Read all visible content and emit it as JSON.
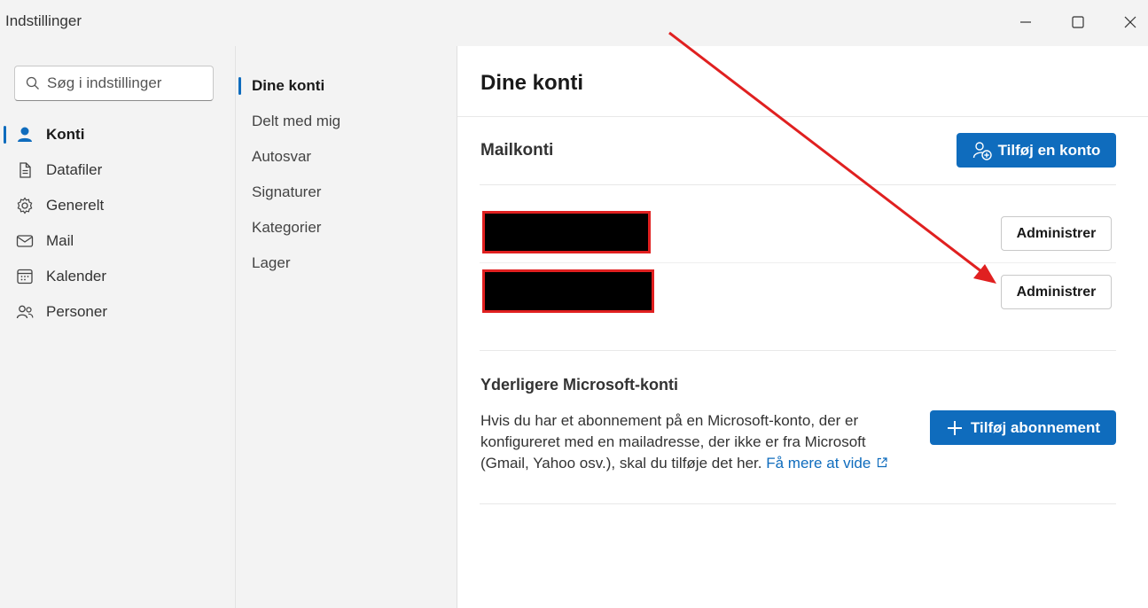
{
  "window": {
    "title": "Indstillinger"
  },
  "search": {
    "placeholder": "Søg i indstillinger"
  },
  "sidebar": {
    "items": [
      {
        "label": "Konti",
        "icon": "person-icon",
        "active": true
      },
      {
        "label": "Datafiler",
        "icon": "document-icon"
      },
      {
        "label": "Generelt",
        "icon": "gear-icon"
      },
      {
        "label": "Mail",
        "icon": "mail-icon"
      },
      {
        "label": "Kalender",
        "icon": "calendar-icon"
      },
      {
        "label": "Personer",
        "icon": "people-icon"
      }
    ]
  },
  "subnav": {
    "items": [
      {
        "label": "Dine konti",
        "active": true
      },
      {
        "label": "Delt med mig"
      },
      {
        "label": "Autosvar"
      },
      {
        "label": "Signaturer"
      },
      {
        "label": "Kategorier"
      },
      {
        "label": "Lager"
      }
    ]
  },
  "main": {
    "title": "Dine konti",
    "mail_section": {
      "title": "Mailkonti",
      "add_button": "Tilføj en konto",
      "accounts": [
        {
          "manage_label": "Administrer"
        },
        {
          "manage_label": "Administrer"
        }
      ]
    },
    "ms_section": {
      "title": "Yderligere Microsoft-konti",
      "description": "Hvis du har et abonnement på en Microsoft-konto, der er konfigureret med en mailadresse, der ikke er fra Microsoft (Gmail, Yahoo osv.), skal du tilføje det her.",
      "link": "Få mere at vide",
      "add_button": "Tilføj abonnement"
    }
  },
  "colors": {
    "accent": "#0f6cbd",
    "annotation_arrow": "#e02020"
  }
}
